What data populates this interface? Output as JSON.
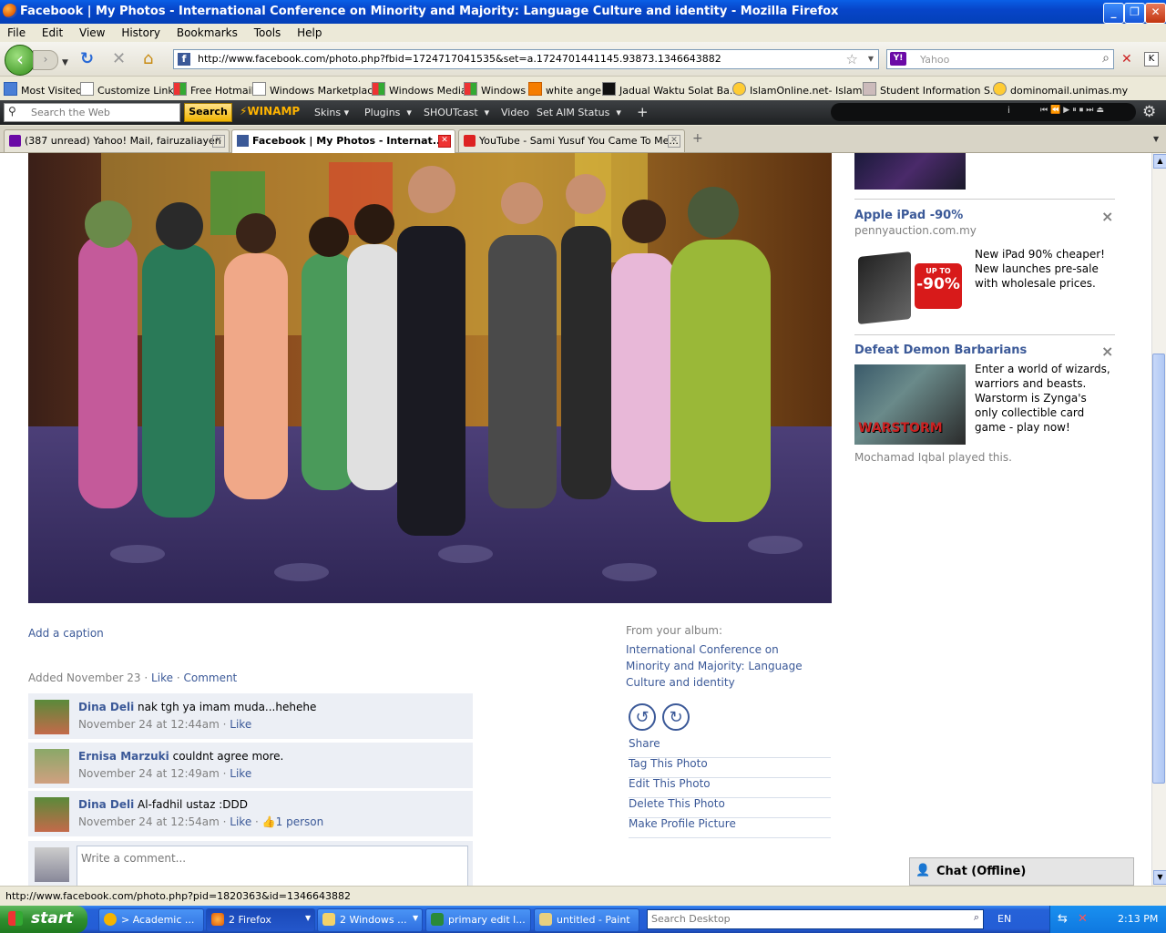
{
  "window": {
    "title": "Facebook | My Photos - International Conference on Minority and Majority: Language Culture and identity - Mozilla Firefox",
    "minimize": "_",
    "restore": "❐",
    "close": "✕"
  },
  "menu": [
    "File",
    "Edit",
    "View",
    "History",
    "Bookmarks",
    "Tools",
    "Help"
  ],
  "nav": {
    "url": "http://www.facebook.com/photo.php?fbid=1724717041535&set=a.1724701441145.93873.1346643882",
    "search_placeholder": "Yahoo"
  },
  "bookmarks": [
    "Most Visited",
    "Customize Links",
    "Free Hotmail",
    "Windows Marketplace",
    "Windows Media",
    "Windows",
    "white angel",
    "Jadual Waktu Solat Ba...",
    "IslamOnline.net- Islam...",
    "Student Information S...",
    "dominomail.unimas.my"
  ],
  "ytoolbar": {
    "search_placeholder": "Search the Web",
    "search_button": "Search",
    "winamp": "WINAMP",
    "items": [
      "Skins",
      "Plugins",
      "SHOUTcast",
      "Video",
      "Set AIM Status"
    ],
    "plus": "+"
  },
  "tabs": [
    {
      "label": "(387 unread) Yahoo! Mail, fairuzaliayen"
    },
    {
      "label": "Facebook | My Photos - Internat..."
    },
    {
      "label": "YouTube - Sami Yusuf You Came To Me..."
    }
  ],
  "tab_new": "+",
  "photo": {
    "add_caption": "Add a caption",
    "added": "Added November 23",
    "like": "Like",
    "comment": "Comment",
    "sep": "·"
  },
  "comments": [
    {
      "name": "Dina Deli",
      "text": "nak tgh ya imam muda...hehehe",
      "time": "November 24 at 12:44am",
      "like": "Like",
      "likes": ""
    },
    {
      "name": "Ernisa Marzuki",
      "text": "couldnt agree more.",
      "time": "November 24 at 12:49am",
      "like": "Like",
      "likes": ""
    },
    {
      "name": "Dina Deli",
      "text": "Al-fadhil ustaz :DDD",
      "time": "November 24 at 12:54am",
      "like": "Like",
      "likes": "1 person"
    }
  ],
  "write_comment": "Write a comment...",
  "album": {
    "from": "From your album:",
    "name": "International Conference on Minority and Majority: Language Culture and identity"
  },
  "actions": [
    "Share",
    "Tag This Photo",
    "Edit This Photo",
    "Delete This Photo",
    "Make Profile Picture"
  ],
  "ads": [
    {
      "title": "Apple iPad -90%",
      "source": "pennyauction.com.my",
      "body": "New iPad 90% cheaper! New launches pre-sale with wholesale prices.",
      "badge_top": "UP TO",
      "badge": "-90%"
    },
    {
      "title": "Defeat Demon Barbarians",
      "source": "",
      "body": "Enter a world of wizards, warriors and beasts. Warstorm is Zynga's only collectible card game - play now!",
      "badge": "WARSTORM"
    }
  ],
  "ad_close": "×",
  "played": "Mochamad Iqbal played this.",
  "chat": "Chat (Offline)",
  "status": "http://www.facebook.com/photo.php?pid=1820363&id=1346643882",
  "taskbar": {
    "start": "start",
    "tasks": [
      "> Academic ...",
      "2 Firefox",
      "2 Windows ...",
      "primary edit l...",
      "untitled - Paint"
    ],
    "search": "Search Desktop",
    "lang": "EN",
    "clock": "2:13 PM"
  }
}
